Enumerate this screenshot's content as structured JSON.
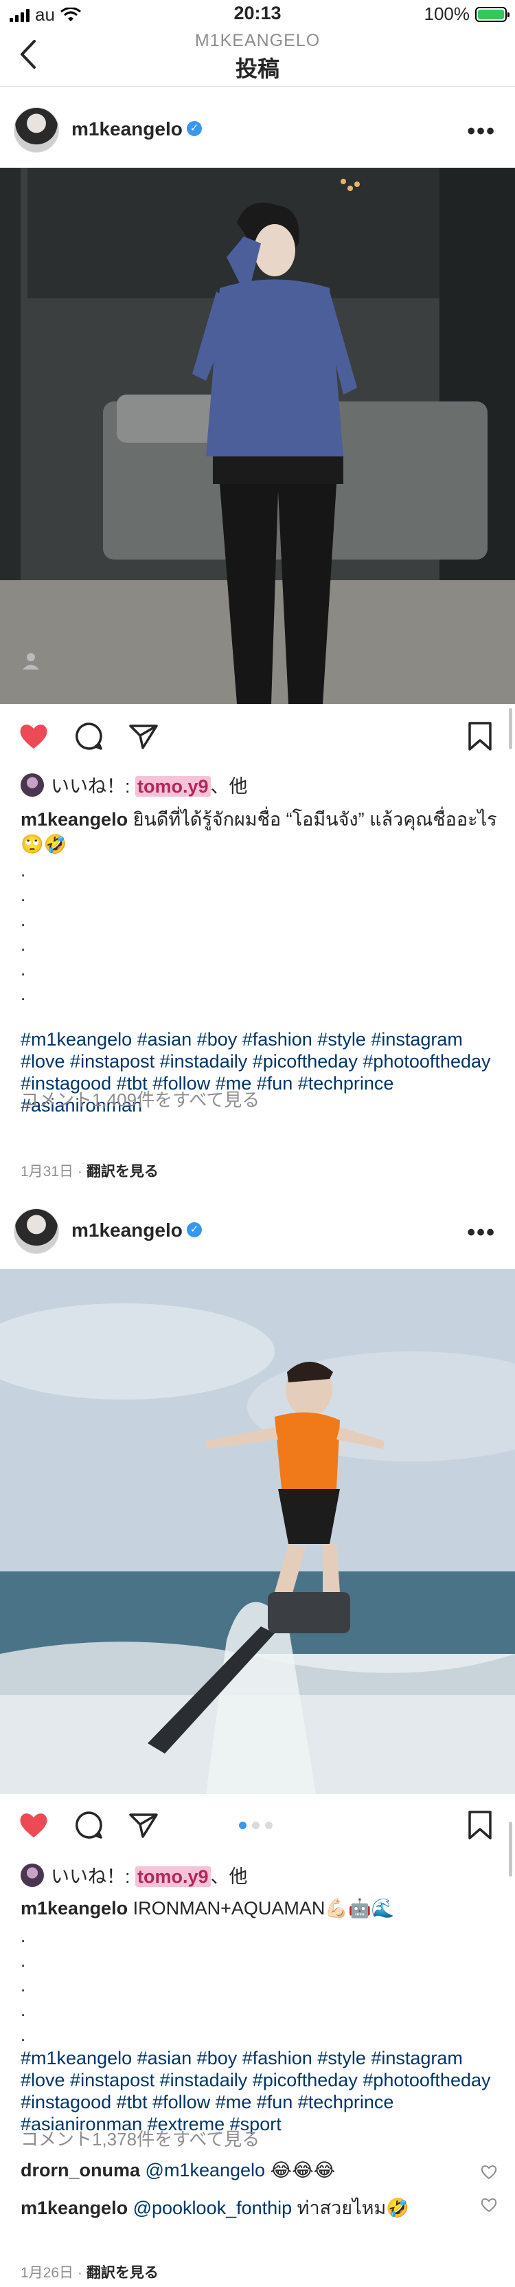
{
  "status": {
    "carrier": "au",
    "time": "20:13",
    "battery": "100%"
  },
  "nav": {
    "subtitle": "M1KEANGELO",
    "title": "投稿"
  },
  "posts": [
    {
      "username": "m1keangelo",
      "likes": {
        "prefix": "いいね！: ",
        "user": "tomo.y9",
        "suffix": "、他"
      },
      "caption": {
        "user": "m1keangelo",
        "text": " ยินดีที่ได้รู้จักผมชื่อ “โอมีนจัง” แล้วคุณชื่ออะไร",
        "emoji": "🙄🤣"
      },
      "dots": [
        ".",
        ".",
        ".",
        ".",
        ".",
        "."
      ],
      "tags": "#m1keangelo #asian #boy #fashion #style #instagram #love #instapost #instadaily #picoftheday #photooftheday #instagood #tbt #follow #me #fun #techprince #asianironman",
      "view_comments": "コメント1,409件をすべて見る",
      "date": "1月31日",
      "translate": "翻訳を見る"
    },
    {
      "username": "m1keangelo",
      "likes": {
        "prefix": "いいね！: ",
        "user": "tomo.y9",
        "suffix": "、他"
      },
      "caption": {
        "user": "m1keangelo",
        "text": " IRONMAN+AQUAMAN",
        "emoji": "💪🏻🤖🌊"
      },
      "dots": [
        ".",
        ".",
        ".",
        ".",
        "."
      ],
      "tags": "#m1keangelo #asian #boy #fashion #style #instagram #love #instapost #instadaily #picoftheday #photooftheday #instagood #tbt #follow #me #fun #techprince #asianironman #extreme #sport",
      "view_comments": "コメント1,378件をすべて見る",
      "comments": [
        {
          "user": "drorn_onuma",
          "mention": "@m1keangelo",
          "text": " 😂😂😂"
        },
        {
          "user": "m1keangelo",
          "mention": "@pooklook_fonthip",
          "text": " ท่าสวยไหม🤣"
        }
      ],
      "date": "1月26日",
      "translate": "翻訳を見る"
    }
  ]
}
